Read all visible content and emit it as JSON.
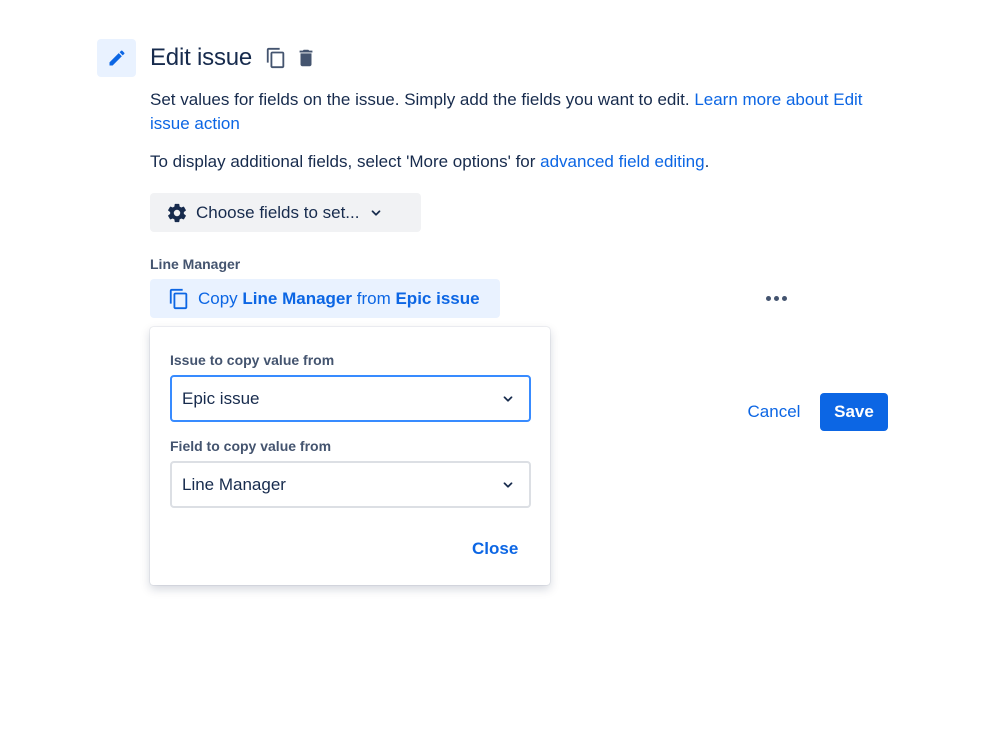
{
  "colors": {
    "accent": "#0c66e4",
    "text": "#172b4d",
    "subtle_text": "#44546f",
    "icon_bg": "#e9f2ff",
    "button_bg": "#f1f2f4"
  },
  "header": {
    "icon": "pencil-icon",
    "title": "Edit issue",
    "actions": [
      {
        "icon": "copy-icon"
      },
      {
        "icon": "trash-icon"
      }
    ]
  },
  "description": {
    "text": "Set values for fields on the issue. Simply add the fields you want to edit. ",
    "link": "Learn more about Edit issue action"
  },
  "additional": {
    "text_before": "To display additional fields, select 'More options' for ",
    "link": "advanced field editing",
    "text_after": "."
  },
  "choose_fields": {
    "icon": "gear-icon",
    "label": "Choose fields to set...",
    "chevron": "chevron-down-icon"
  },
  "field": {
    "label": "Line Manager",
    "copy": {
      "icon": "copy-icon",
      "prefix": "Copy ",
      "field_name": "Line Manager",
      "middle": " from ",
      "source": "Epic issue"
    },
    "more_icon": "more-horizontal-icon"
  },
  "popup": {
    "issue_label": "Issue to copy value from",
    "issue_value": "Epic issue",
    "field_label": "Field to copy value from",
    "field_value": "Line Manager",
    "close_label": "Close"
  },
  "footer": {
    "cancel_label": "Cancel",
    "save_label": "Save"
  }
}
